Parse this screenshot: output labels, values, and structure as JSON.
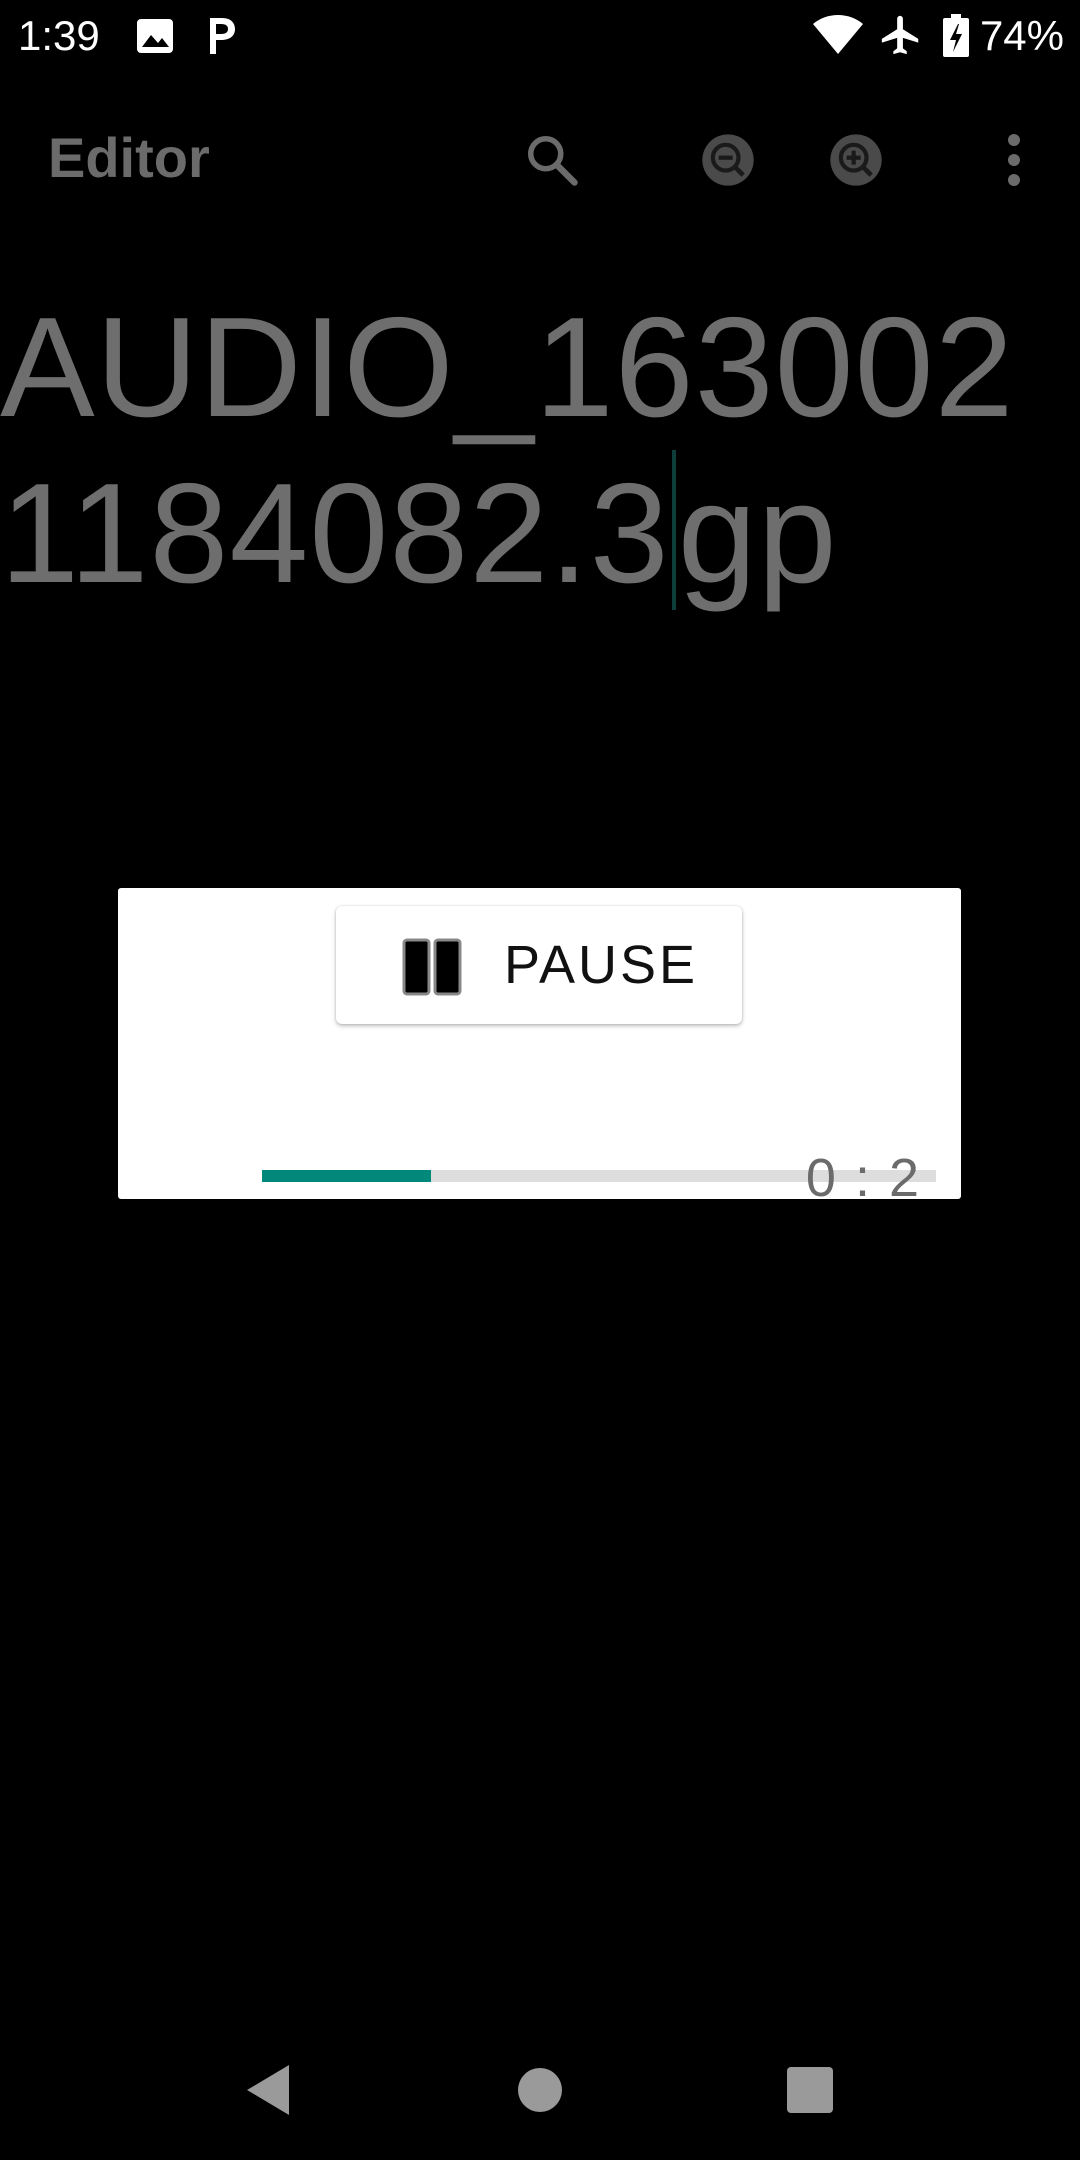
{
  "status_bar": {
    "time": "1:39",
    "battery_percent": "74%",
    "icons": [
      "image-notification-icon",
      "p-app-icon",
      "wifi-icon",
      "airplane-mode-icon",
      "battery-charging-icon"
    ]
  },
  "toolbar": {
    "title": "Editor",
    "actions": [
      "search-icon",
      "zoom-out-icon",
      "zoom-in-icon",
      "more-vert-icon"
    ]
  },
  "editor": {
    "text_before_caret": "AUDIO_1630021184082.3",
    "text_after_caret": "gp"
  },
  "player": {
    "pause_label": "PAUSE",
    "time": "0 : 2",
    "progress_fraction": 0.25,
    "accent_color": "#00897b"
  },
  "nav_bar": {
    "buttons": [
      "back-icon",
      "home-icon",
      "recents-icon"
    ]
  }
}
